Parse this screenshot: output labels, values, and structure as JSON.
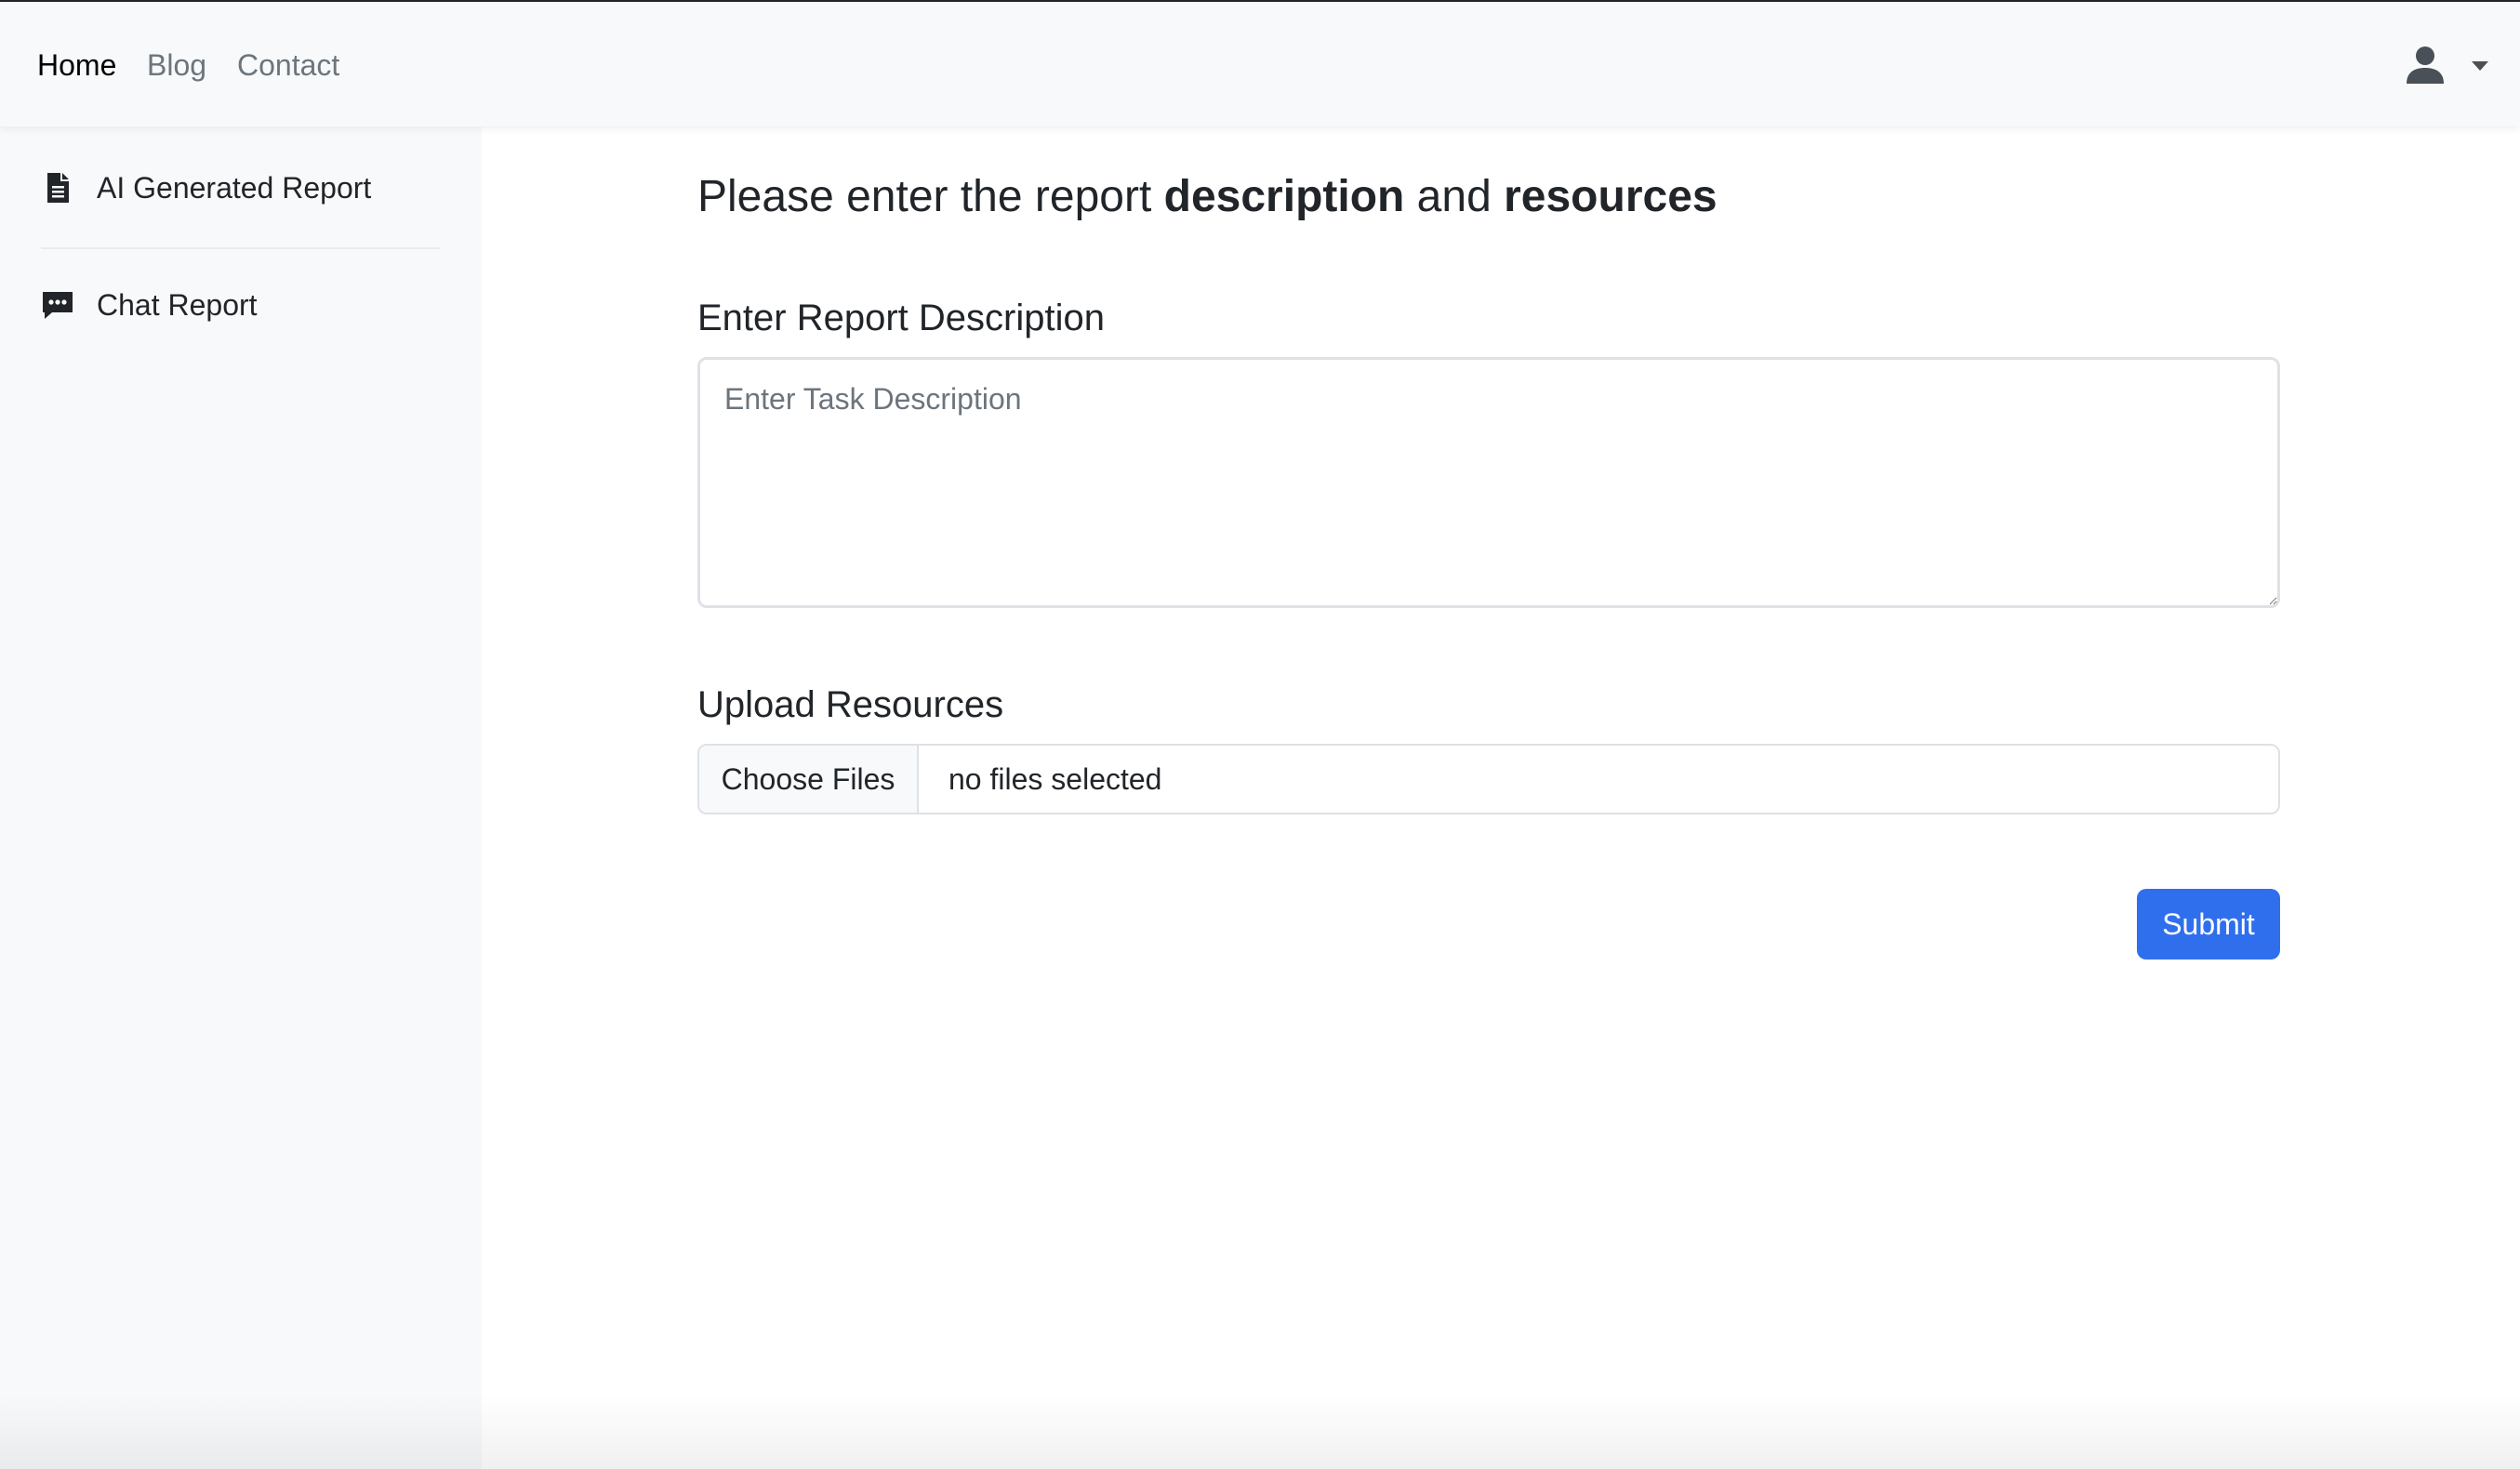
{
  "topnav": {
    "links": [
      "Home",
      "Blog",
      "Contact"
    ],
    "active": "Home",
    "user_menu_icon": "user-icon",
    "caret_icon": "caret-down-icon"
  },
  "sidebar": {
    "items": [
      {
        "label": "AI Generated Report",
        "icon": "file-icon"
      },
      {
        "label": "Chat Report",
        "icon": "chat-icon"
      }
    ]
  },
  "main": {
    "heading": {
      "prefix": "Please enter the report ",
      "bold1": "description",
      "middle": " and ",
      "bold2": "resources"
    },
    "description_label": "Enter Report Description",
    "description_placeholder": "Enter Task Description",
    "description_value": "",
    "resources_label": "Upload Resources",
    "file_button_label": "Choose Files",
    "file_status": "no files selected",
    "submit_label": "Submit"
  },
  "colors": {
    "primary": "#2f6fed",
    "sidebar_bg": "#f8f9fa",
    "text": "#212529",
    "muted": "#6c757d"
  }
}
